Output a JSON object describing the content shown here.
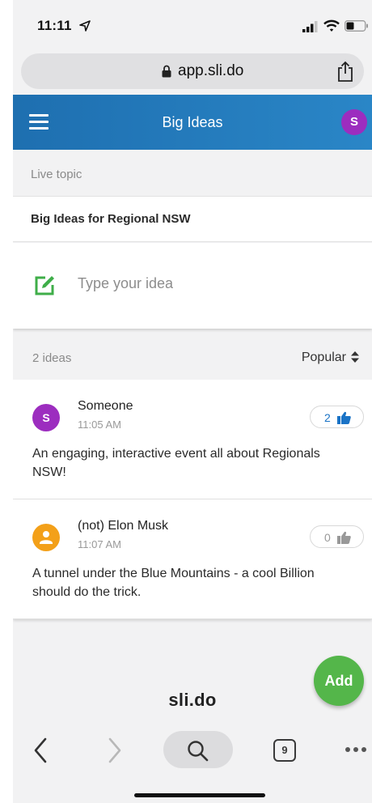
{
  "status_bar": {
    "time": "11:11"
  },
  "browser": {
    "url": "app.sli.do",
    "tab_count": "9"
  },
  "app_header": {
    "title": "Big Ideas",
    "user_initial": "S"
  },
  "live": {
    "label": "Live topic",
    "topic": "Big Ideas for Regional NSW"
  },
  "compose": {
    "placeholder": "Type your idea"
  },
  "ideas_header": {
    "count_label": "2 ideas",
    "sort_label": "Popular"
  },
  "ideas": [
    {
      "initial": "S",
      "author": "Someone",
      "time": "11:05 AM",
      "text": "An engaging, interactive event all about Regionals NSW!",
      "likes": "2",
      "avatar_color": "#9c2dbf",
      "liked": true
    },
    {
      "initial": "",
      "author": "(not) Elon Musk",
      "time": "11:07 AM",
      "text": "A tunnel under the Blue Mountains - a cool Billion should do the trick.",
      "likes": "0",
      "avatar_color": "#f3a019",
      "liked": false
    }
  ],
  "fab": {
    "label": "Add"
  },
  "footer": {
    "brand": "sli.do"
  },
  "colors": {
    "header_start": "#1e6fb0",
    "header_end": "#2a86c7",
    "accent_blue": "#1a73c6",
    "fab_green": "#54b64a",
    "compose_green": "#3fae49"
  }
}
